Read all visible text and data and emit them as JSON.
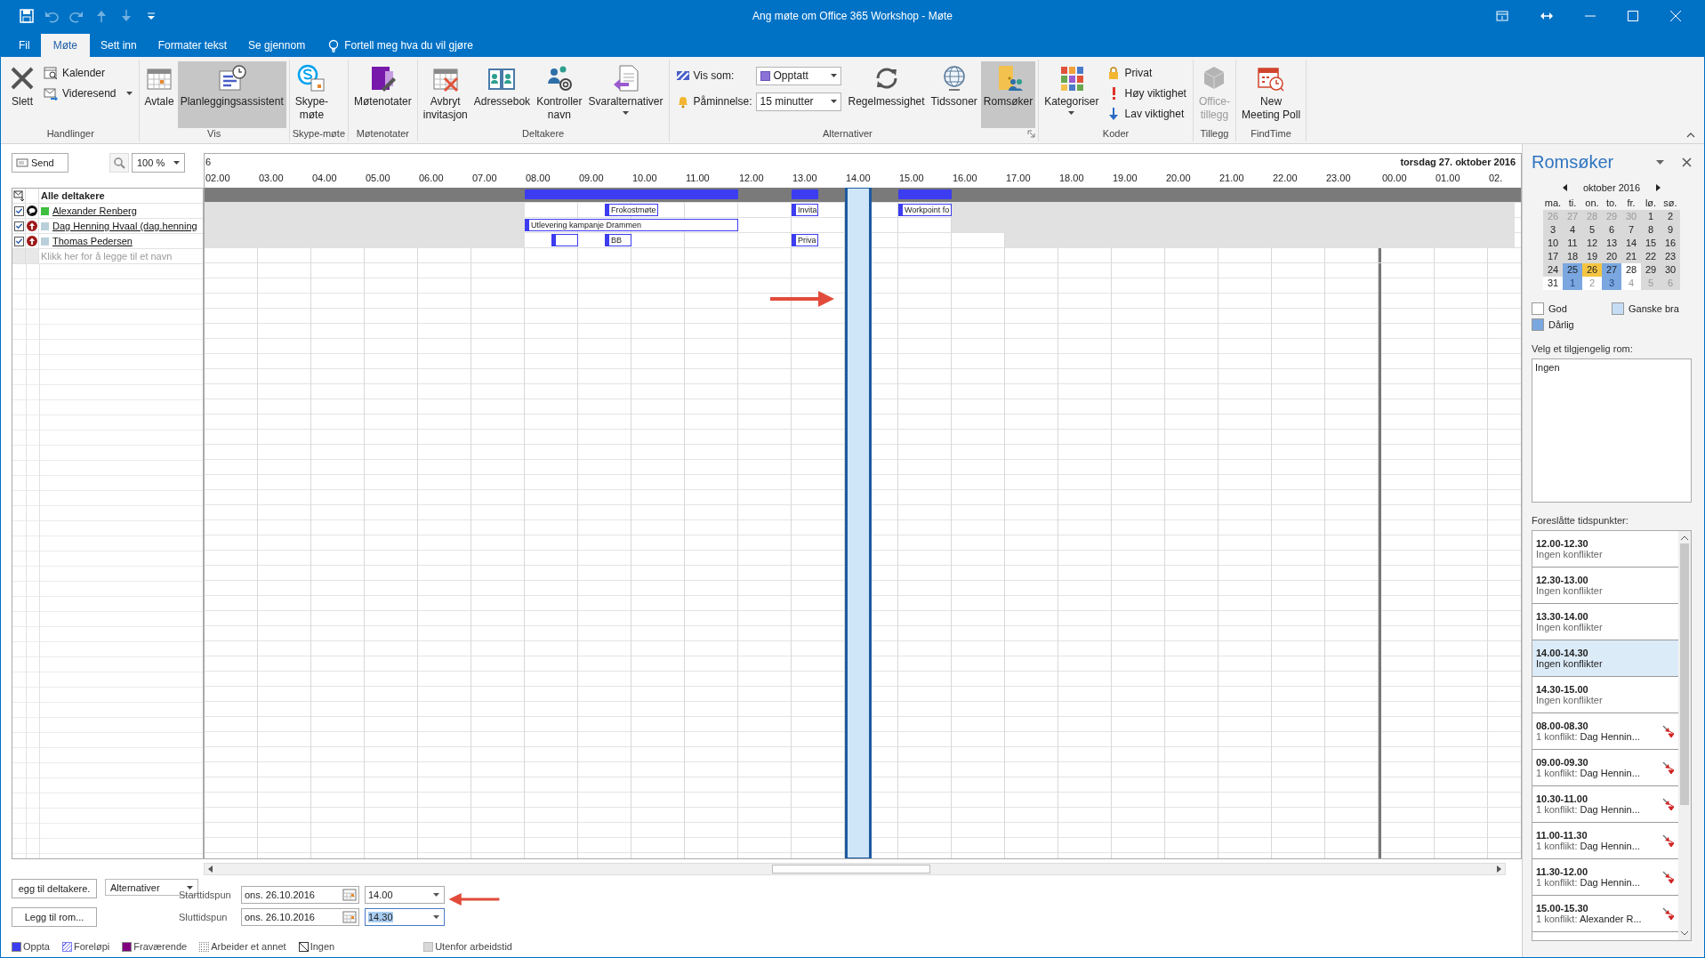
{
  "window": {
    "title": "Ang møte om Office 365 Workshop - Møte"
  },
  "quick_access": [
    {
      "kind": "save",
      "disabled": false
    },
    {
      "kind": "undo",
      "disabled": true
    },
    {
      "kind": "redo",
      "disabled": true
    },
    {
      "kind": "up",
      "disabled": true
    },
    {
      "kind": "down",
      "disabled": true
    },
    {
      "kind": "customize",
      "disabled": false
    }
  ],
  "tabs": [
    {
      "label": "Fil",
      "selected": false
    },
    {
      "label": "Møte",
      "selected": true
    },
    {
      "label": "Sett inn",
      "selected": false
    },
    {
      "label": "Formater tekst",
      "selected": false
    },
    {
      "label": "Se gjennom",
      "selected": false
    }
  ],
  "tell_me": "Fortell meg hva du vil gjøre",
  "ribbon": {
    "groups": [
      {
        "label": "Handlinger",
        "launcher": false,
        "items": [
          {
            "kind": "delete",
            "label": "Slett",
            "selected": false,
            "disabled": false,
            "dropdown": false
          },
          {
            "kind": "stack",
            "items": [
              {
                "kind": "calendar",
                "label": "Kalender",
                "dropdown": false
              },
              {
                "kind": "forward",
                "label": "Videresend",
                "dropdown": true
              }
            ]
          }
        ]
      },
      {
        "label": "Vis",
        "launcher": false,
        "items": [
          {
            "kind": "appointment",
            "label": "Avtale",
            "selected": false,
            "disabled": false,
            "dropdown": false
          },
          {
            "kind": "scheduling",
            "label": "Planleggingsassistent",
            "selected": true,
            "disabled": false,
            "dropdown": false
          }
        ]
      },
      {
        "label": "Skype-møte",
        "launcher": false,
        "items": [
          {
            "kind": "skype",
            "label": "Skype-\nmøte",
            "selected": false,
            "disabled": false,
            "dropdown": false
          }
        ]
      },
      {
        "label": "Møtenotater",
        "launcher": false,
        "items": [
          {
            "kind": "onenote",
            "label": "Møtenotater",
            "selected": false,
            "disabled": false,
            "dropdown": false
          }
        ]
      },
      {
        "label": "Deltakere",
        "launcher": false,
        "items": [
          {
            "kind": "cancel",
            "label": "Avbryt\ninvitasjon",
            "selected": false,
            "disabled": false,
            "dropdown": false
          },
          {
            "kind": "addressbook",
            "label": "Adressebok",
            "selected": false,
            "disabled": false,
            "dropdown": false
          },
          {
            "kind": "checknames",
            "label": "Kontroller\nnavn",
            "selected": false,
            "disabled": false,
            "dropdown": false
          },
          {
            "kind": "response",
            "label": "Svaralternativer",
            "selected": false,
            "disabled": false,
            "dropdown": true
          }
        ]
      },
      {
        "label": "Alternativer",
        "launcher": true,
        "items": [
          {
            "kind": "stack",
            "items": [
              {
                "kind": "showas",
                "label": "Vis som:",
                "value": "Opptatt"
              },
              {
                "kind": "reminder",
                "label": "Påminnelse:",
                "value": "15 minutter"
              }
            ]
          },
          {
            "kind": "recurrence",
            "label": "Regelmessighet",
            "selected": false,
            "disabled": false,
            "dropdown": false
          },
          {
            "kind": "timezones",
            "label": "Tidssoner",
            "selected": false,
            "disabled": false,
            "dropdown": false
          },
          {
            "kind": "roomfinder",
            "label": "Romsøker",
            "selected": true,
            "disabled": false,
            "dropdown": false
          }
        ]
      },
      {
        "label": "Koder",
        "launcher": false,
        "items": [
          {
            "kind": "categorize",
            "label": "Kategoriser",
            "selected": false,
            "disabled": false,
            "dropdown": true
          },
          {
            "kind": "stack",
            "items": [
              {
                "kind": "private",
                "label": "Privat",
                "dropdown": false
              },
              {
                "kind": "high",
                "label": "Høy viktighet",
                "dropdown": false
              },
              {
                "kind": "low",
                "label": "Lav viktighet",
                "dropdown": false
              }
            ]
          }
        ]
      },
      {
        "label": "Tillegg",
        "launcher": false,
        "items": [
          {
            "kind": "addins",
            "label": "Office-\ntillegg",
            "selected": false,
            "disabled": true,
            "dropdown": false
          }
        ]
      },
      {
        "label": "FindTime",
        "launcher": false,
        "items": [
          {
            "kind": "poll",
            "label": "New\nMeeting Poll",
            "selected": false,
            "disabled": false,
            "dropdown": false
          }
        ]
      }
    ]
  },
  "send_button": "Send",
  "zoom": "100 %",
  "date_start": "6",
  "date_next": "torsdag 27. oktober 2016",
  "hours": [
    "02.00",
    "03.00",
    "04.00",
    "05.00",
    "06.00",
    "07.00",
    "08.00",
    "09.00",
    "10.00",
    "11.00",
    "12.00",
    "13.00",
    "14.00",
    "15.00",
    "16.00",
    "17.00",
    "18.00",
    "19.00",
    "20.00",
    "21.00",
    "22.00",
    "23.00"
  ],
  "next_day_hours": [
    "00.00",
    "01.00",
    "02."
  ],
  "all_attendees": {
    "label": "Alle deltakere",
    "slots": [
      {
        "kind": "free"
      },
      {
        "kind": "free"
      },
      {
        "kind": "free"
      },
      {
        "kind": "free"
      },
      {
        "kind": "free"
      },
      {
        "kind": "free"
      },
      {
        "kind": "free"
      },
      {
        "kind": "free"
      },
      {
        "kind": "free"
      },
      {
        "kind": "free"
      },
      {
        "kind": "free"
      },
      {
        "kind": "free"
      },
      {
        "kind": "busy"
      },
      {
        "kind": "more"
      },
      {
        "kind": "more"
      },
      {
        "kind": "more"
      },
      {
        "kind": "more"
      },
      {
        "kind": "more"
      },
      {
        "kind": "more"
      },
      {
        "kind": "more"
      },
      {
        "kind": "free"
      },
      {
        "kind": "free"
      },
      {
        "kind": "busy"
      },
      {
        "kind": "free"
      },
      {
        "kind": "free"
      },
      {
        "kind": "free"
      },
      {
        "kind": "busy"
      },
      {
        "kind": "more"
      },
      {
        "kind": "free"
      },
      {
        "kind": "free"
      },
      {
        "kind": "free"
      },
      {
        "kind": "free"
      },
      {
        "kind": "free"
      },
      {
        "kind": "free"
      },
      {
        "kind": "free"
      },
      {
        "kind": "free"
      },
      {
        "kind": "free"
      },
      {
        "kind": "free"
      },
      {
        "kind": "free"
      },
      {
        "kind": "free"
      },
      {
        "kind": "free"
      },
      {
        "kind": "free"
      },
      {
        "kind": "free"
      },
      {
        "kind": "free"
      },
      {
        "kind": "free"
      },
      {
        "kind": "free"
      },
      {
        "kind": "free"
      },
      {
        "kind": "free"
      },
      {
        "kind": "free"
      }
    ]
  },
  "participants": [
    {
      "name": "Alexander Renberg",
      "checked": true,
      "kind": "organizer",
      "color": "#3fbf3f",
      "slots": [
        {
          "kind": "off"
        },
        {
          "kind": "off"
        },
        {
          "kind": "off"
        },
        {
          "kind": "off"
        },
        {
          "kind": "off"
        },
        {
          "kind": "off"
        },
        {
          "kind": "off"
        },
        {
          "kind": "off"
        },
        {
          "kind": "off"
        },
        {
          "kind": "off"
        },
        {
          "kind": "off"
        },
        {
          "kind": "off"
        },
        {
          "kind": "free"
        },
        {
          "kind": "free"
        },
        {
          "kind": "free"
        },
        {
          "kind": "busy",
          "label": "Frokostmøte"
        },
        {
          "kind": "more"
        },
        {
          "kind": "free"
        },
        {
          "kind": "free"
        },
        {
          "kind": "free"
        },
        {
          "kind": "free"
        },
        {
          "kind": "free"
        },
        {
          "kind": "busy",
          "label": "Invita"
        },
        {
          "kind": "free"
        },
        {
          "kind": "free"
        },
        {
          "kind": "free"
        },
        {
          "kind": "busy",
          "label": "Workpoint fo"
        },
        {
          "kind": "more"
        },
        {
          "kind": "off"
        },
        {
          "kind": "off"
        },
        {
          "kind": "off"
        },
        {
          "kind": "off"
        },
        {
          "kind": "off"
        },
        {
          "kind": "off"
        },
        {
          "kind": "off"
        },
        {
          "kind": "off"
        },
        {
          "kind": "off"
        },
        {
          "kind": "off"
        },
        {
          "kind": "off"
        },
        {
          "kind": "off"
        },
        {
          "kind": "off"
        },
        {
          "kind": "off"
        },
        {
          "kind": "off"
        },
        {
          "kind": "off"
        },
        {
          "kind": "off"
        },
        {
          "kind": "off"
        },
        {
          "kind": "off"
        },
        {
          "kind": "off"
        },
        {
          "kind": "off"
        }
      ]
    },
    {
      "name": "Dag Henning Hvaal (dag.henning",
      "checked": true,
      "kind": "required",
      "color": "#b9cfdb",
      "slots": [
        {
          "kind": "off"
        },
        {
          "kind": "off"
        },
        {
          "kind": "off"
        },
        {
          "kind": "off"
        },
        {
          "kind": "off"
        },
        {
          "kind": "off"
        },
        {
          "kind": "off"
        },
        {
          "kind": "off"
        },
        {
          "kind": "off"
        },
        {
          "kind": "off"
        },
        {
          "kind": "off"
        },
        {
          "kind": "off"
        },
        {
          "kind": "busy",
          "label": "Utlevering kampanje Drammen"
        },
        {
          "kind": "more"
        },
        {
          "kind": "more"
        },
        {
          "kind": "more"
        },
        {
          "kind": "more"
        },
        {
          "kind": "more"
        },
        {
          "kind": "more"
        },
        {
          "kind": "more"
        },
        {
          "kind": "free"
        },
        {
          "kind": "free"
        },
        {
          "kind": "free"
        },
        {
          "kind": "free"
        },
        {
          "kind": "free"
        },
        {
          "kind": "free"
        },
        {
          "kind": "free"
        },
        {
          "kind": "free"
        },
        {
          "kind": "off"
        },
        {
          "kind": "off"
        },
        {
          "kind": "off"
        },
        {
          "kind": "off"
        },
        {
          "kind": "off"
        },
        {
          "kind": "off"
        },
        {
          "kind": "off"
        },
        {
          "kind": "off"
        },
        {
          "kind": "off"
        },
        {
          "kind": "off"
        },
        {
          "kind": "off"
        },
        {
          "kind": "off"
        },
        {
          "kind": "off"
        },
        {
          "kind": "off"
        },
        {
          "kind": "off"
        },
        {
          "kind": "off"
        },
        {
          "kind": "off"
        },
        {
          "kind": "off"
        },
        {
          "kind": "off"
        },
        {
          "kind": "off"
        },
        {
          "kind": "off"
        }
      ]
    },
    {
      "name": "Thomas Pedersen",
      "checked": true,
      "kind": "required",
      "color": "#b9cfdb",
      "slots": [
        {
          "kind": "off"
        },
        {
          "kind": "off"
        },
        {
          "kind": "off"
        },
        {
          "kind": "off"
        },
        {
          "kind": "off"
        },
        {
          "kind": "off"
        },
        {
          "kind": "off"
        },
        {
          "kind": "off"
        },
        {
          "kind": "off"
        },
        {
          "kind": "off"
        },
        {
          "kind": "off"
        },
        {
          "kind": "off"
        },
        {
          "kind": "free"
        },
        {
          "kind": "busy"
        },
        {
          "kind": "free"
        },
        {
          "kind": "busy",
          "label": "BB"
        },
        {
          "kind": "free"
        },
        {
          "kind": "free"
        },
        {
          "kind": "free"
        },
        {
          "kind": "free"
        },
        {
          "kind": "free"
        },
        {
          "kind": "free"
        },
        {
          "kind": "busy",
          "label": "Priva"
        },
        {
          "kind": "free"
        },
        {
          "kind": "free"
        },
        {
          "kind": "free"
        },
        {
          "kind": "free"
        },
        {
          "kind": "free"
        },
        {
          "kind": "free"
        },
        {
          "kind": "free"
        },
        {
          "kind": "off"
        },
        {
          "kind": "off"
        },
        {
          "kind": "off"
        },
        {
          "kind": "off"
        },
        {
          "kind": "off"
        },
        {
          "kind": "off"
        },
        {
          "kind": "off"
        },
        {
          "kind": "off"
        },
        {
          "kind": "off"
        },
        {
          "kind": "off"
        },
        {
          "kind": "off"
        },
        {
          "kind": "off"
        },
        {
          "kind": "off"
        },
        {
          "kind": "off"
        },
        {
          "kind": "off"
        },
        {
          "kind": "off"
        },
        {
          "kind": "off"
        },
        {
          "kind": "off"
        },
        {
          "kind": "off"
        }
      ]
    }
  ],
  "add_name_placeholder": "Klikk her for å legge til et navn",
  "add_attendees_button": "egg til deltakere.",
  "options_dropdown": "Alternativer",
  "add_room_button": "Legg til rom...",
  "start": {
    "label": "Starttidspun",
    "date": "ons. 26.10.2016",
    "time": "14.00",
    "time_highlighted": false
  },
  "end": {
    "label": "Sluttidspun",
    "date": "ons. 26.10.2016",
    "time": "14.30",
    "time_highlighted": true
  },
  "legend": [
    {
      "kind": "solid",
      "label": "Oppta",
      "color": "#3c3cf0"
    },
    {
      "kind": "hatched",
      "label": "Foreløpi",
      "color": "#7c7cf0"
    },
    {
      "kind": "solid",
      "label": "Fraværende",
      "color": "#800080"
    },
    {
      "kind": "dotted",
      "label": "Arbeider et annet",
      "color": "#666666"
    },
    {
      "kind": "none",
      "label": "Ingen",
      "color": "#333333"
    },
    {
      "kind": "offhours",
      "label": "Utenfor arbeidstid",
      "color": "#d8d8d8"
    }
  ],
  "room_finder": {
    "title": "Romsøker",
    "month": "oktober 2016",
    "weekdays": [
      "ma.",
      "ti.",
      "on.",
      "to.",
      "fr.",
      "lø.",
      "sø."
    ],
    "weeks": [
      [
        {
          "day": "26",
          "other_month": true,
          "kind": "unavailable"
        },
        {
          "day": "27",
          "other_month": true,
          "kind": "unavailable"
        },
        {
          "day": "28",
          "other_month": true,
          "kind": "unavailable"
        },
        {
          "day": "29",
          "other_month": true,
          "kind": "unavailable"
        },
        {
          "day": "30",
          "other_month": true,
          "kind": "unavailable"
        },
        {
          "day": "1",
          "other_month": false,
          "kind": "unavailable"
        },
        {
          "day": "2",
          "other_month": false,
          "kind": "unavailable"
        }
      ],
      [
        {
          "day": "3",
          "other_month": false,
          "kind": "unavailable"
        },
        {
          "day": "4",
          "other_month": false,
          "kind": "unavailable"
        },
        {
          "day": "5",
          "other_month": false,
          "kind": "unavailable"
        },
        {
          "day": "6",
          "other_month": false,
          "kind": "unavailable"
        },
        {
          "day": "7",
          "other_month": false,
          "kind": "unavailable"
        },
        {
          "day": "8",
          "other_month": false,
          "kind": "unavailable"
        },
        {
          "day": "9",
          "other_month": false,
          "kind": "unavailable"
        }
      ],
      [
        {
          "day": "10",
          "other_month": false,
          "kind": "unavailable"
        },
        {
          "day": "11",
          "other_month": false,
          "kind": "unavailable"
        },
        {
          "day": "12",
          "other_month": false,
          "kind": "unavailable"
        },
        {
          "day": "13",
          "other_month": false,
          "kind": "unavailable"
        },
        {
          "day": "14",
          "other_month": false,
          "kind": "unavailable"
        },
        {
          "day": "15",
          "other_month": false,
          "kind": "unavailable"
        },
        {
          "day": "16",
          "other_month": false,
          "kind": "unavailable"
        }
      ],
      [
        {
          "day": "17",
          "other_month": false,
          "kind": "unavailable"
        },
        {
          "day": "18",
          "other_month": false,
          "kind": "unavailable"
        },
        {
          "day": "19",
          "other_month": false,
          "kind": "unavailable"
        },
        {
          "day": "20",
          "other_month": false,
          "kind": "unavailable"
        },
        {
          "day": "21",
          "other_month": false,
          "kind": "unavailable"
        },
        {
          "day": "22",
          "other_month": false,
          "kind": "unavailable"
        },
        {
          "day": "23",
          "other_month": false,
          "kind": "unavailable"
        }
      ],
      [
        {
          "day": "24",
          "other_month": false,
          "kind": "unavailable"
        },
        {
          "day": "25",
          "other_month": false,
          "kind": "poor"
        },
        {
          "day": "26",
          "other_month": false,
          "kind": "selected"
        },
        {
          "day": "27",
          "other_month": false,
          "kind": "poor"
        },
        {
          "day": "28",
          "other_month": false,
          "kind": "good"
        },
        {
          "day": "29",
          "other_month": false,
          "kind": "unavailable"
        },
        {
          "day": "30",
          "other_month": false,
          "kind": "unavailable"
        }
      ],
      [
        {
          "day": "31",
          "other_month": false,
          "kind": "good"
        },
        {
          "day": "1",
          "other_month": true,
          "kind": "poor"
        },
        {
          "day": "2",
          "other_month": true,
          "kind": "good"
        },
        {
          "day": "3",
          "other_month": true,
          "kind": "poor"
        },
        {
          "day": "4",
          "other_month": true,
          "kind": "good"
        },
        {
          "day": "5",
          "other_month": true,
          "kind": "unavailable"
        },
        {
          "day": "6",
          "other_month": true,
          "kind": "unavailable"
        }
      ]
    ],
    "legend": [
      {
        "label": "God",
        "color": "#ffffff"
      },
      {
        "label": "Ganske bra",
        "color": "#c5dcf5"
      },
      {
        "label": "Dårlig",
        "color": "#7aa7e0"
      }
    ],
    "rooms_label": "Velg et tilgjengelig rom:",
    "rooms": [
      {
        "name": "Ingen"
      }
    ],
    "suggestions_label": "Foreslåtte tidspunkter:",
    "suggestions": [
      {
        "time": "12.00-12.30",
        "kind": "free",
        "note": "Ingen konflikter",
        "selected": false
      },
      {
        "time": "12.30-13.00",
        "kind": "free",
        "note": "Ingen konflikter",
        "selected": false
      },
      {
        "time": "13.30-14.00",
        "kind": "free",
        "note": "Ingen konflikter",
        "selected": false
      },
      {
        "time": "14.00-14.30",
        "kind": "free",
        "note": "Ingen konflikter",
        "selected": true
      },
      {
        "time": "14.30-15.00",
        "kind": "free",
        "note": "Ingen konflikter",
        "selected": false
      },
      {
        "time": "08.00-08.30",
        "kind": "conflict",
        "note": "1 konflikt:",
        "who": "Dag Hennin...",
        "selected": false
      },
      {
        "time": "09.00-09.30",
        "kind": "conflict",
        "note": "1 konflikt:",
        "who": "Dag Hennin...",
        "selected": false
      },
      {
        "time": "10.30-11.00",
        "kind": "conflict",
        "note": "1 konflikt:",
        "who": "Dag Hennin...",
        "selected": false
      },
      {
        "time": "11.00-11.30",
        "kind": "conflict",
        "note": "1 konflikt:",
        "who": "Dag Hennin...",
        "selected": false
      },
      {
        "time": "11.30-12.00",
        "kind": "conflict",
        "note": "1 konflikt:",
        "who": "Dag Hennin...",
        "selected": false
      },
      {
        "time": "15.00-15.30",
        "kind": "conflict",
        "note": "1 konflikt:",
        "who": "Alexander R...",
        "selected": false
      }
    ]
  },
  "annotations": [
    {
      "kind": "arrow-right"
    },
    {
      "kind": "arrow-left"
    }
  ]
}
